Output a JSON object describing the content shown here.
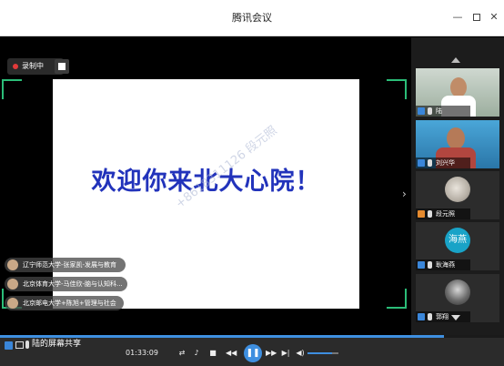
{
  "window": {
    "title": "腾讯会议",
    "minimize_icon": "minimize-icon",
    "maximize_icon": "maximize-icon",
    "close_icon": "close-icon"
  },
  "recording": {
    "label": "录制中",
    "indicator_color": "#e23a3a"
  },
  "slide": {
    "headline": "欢迎你来北大心院！",
    "watermark": "+8618311126   段元照",
    "headline_color": "#2233bb"
  },
  "chat": [
    {
      "text": "辽宁师范大学-张家凯-发展与教育"
    },
    {
      "text": "北京体育大学-马佳欣-脑与认知科..."
    },
    {
      "text": "北京邮电大学+陈旭+管理与社会"
    }
  ],
  "participants": [
    {
      "name": "陆"
    },
    {
      "name": "刘兴华"
    },
    {
      "name": "段元照"
    },
    {
      "name": "耿海燕",
      "avatar_text": "海燕"
    },
    {
      "name": "郭翔"
    }
  ],
  "share": {
    "label": "陆的屏幕共享",
    "progress": 0.88
  },
  "player": {
    "time": "01:33:09",
    "volume": 0.8
  },
  "colors": {
    "accent": "#3e8fe0",
    "frame": "#2bbd78"
  }
}
